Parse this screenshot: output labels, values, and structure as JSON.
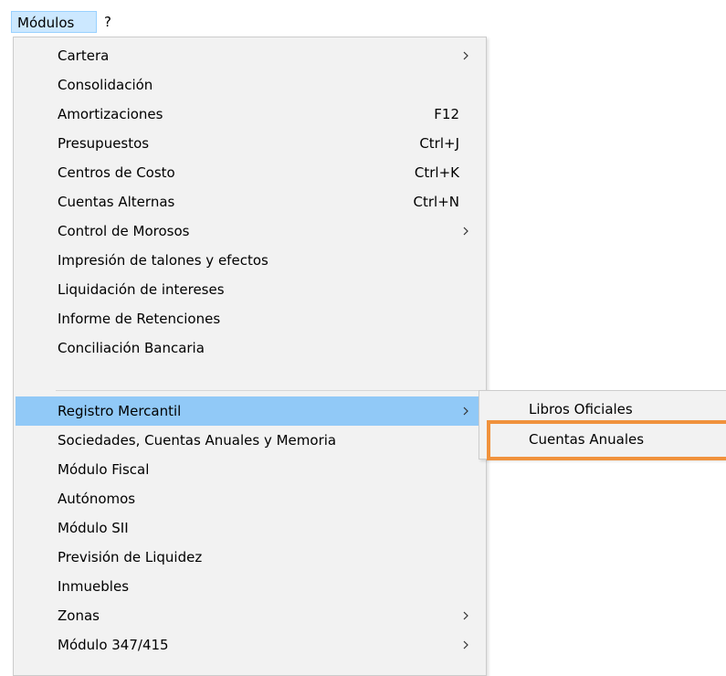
{
  "menubar": {
    "items": [
      {
        "label": "Módulos",
        "active": true
      },
      {
        "label": "?",
        "active": false
      }
    ]
  },
  "menu": {
    "items": [
      {
        "label": "Cartera",
        "shortcut": "",
        "submenu": true
      },
      {
        "label": "Consolidación",
        "shortcut": "",
        "submenu": false
      },
      {
        "label": "Amortizaciones",
        "shortcut": "F12",
        "submenu": false
      },
      {
        "label": "Presupuestos",
        "shortcut": "Ctrl+J",
        "submenu": false
      },
      {
        "label": "Centros de Costo",
        "shortcut": "Ctrl+K",
        "submenu": false
      },
      {
        "label": "Cuentas Alternas",
        "shortcut": "Ctrl+N",
        "submenu": false
      },
      {
        "label": "Control de Morosos",
        "shortcut": "",
        "submenu": true
      },
      {
        "label": "Impresión de talones y efectos",
        "shortcut": "",
        "submenu": false
      },
      {
        "label": "Liquidación de intereses",
        "shortcut": "",
        "submenu": false
      },
      {
        "label": "Informe de Retenciones",
        "shortcut": "",
        "submenu": false
      },
      {
        "label": "Conciliación Bancaria",
        "shortcut": "",
        "submenu": false
      },
      {
        "label": "Registro Mercantil",
        "shortcut": "",
        "submenu": true,
        "highlighted": true
      },
      {
        "label": "Sociedades, Cuentas Anuales y Memoria",
        "shortcut": "",
        "submenu": false
      },
      {
        "label": "Módulo Fiscal",
        "shortcut": "",
        "submenu": false
      },
      {
        "label": "Autónomos",
        "shortcut": "",
        "submenu": false
      },
      {
        "label": "Módulo SII",
        "shortcut": "",
        "submenu": false
      },
      {
        "label": "Previsión de Liquidez",
        "shortcut": "",
        "submenu": false
      },
      {
        "label": "Inmuebles",
        "shortcut": "",
        "submenu": false
      },
      {
        "label": "Zonas",
        "shortcut": "",
        "submenu": true
      },
      {
        "label": "Módulo 347/415",
        "shortcut": "",
        "submenu": true
      }
    ]
  },
  "submenu": {
    "items": [
      {
        "label": "Libros Oficiales"
      },
      {
        "label": "Cuentas Anuales",
        "outlined": true
      }
    ]
  },
  "colors": {
    "menu_background": "#f2f2f2",
    "highlight": "#91c9f7",
    "menubar_active": "#cce8ff",
    "annotation_outline": "#f0923d"
  },
  "icons": {
    "submenu_arrow": "chevron-right-icon"
  }
}
